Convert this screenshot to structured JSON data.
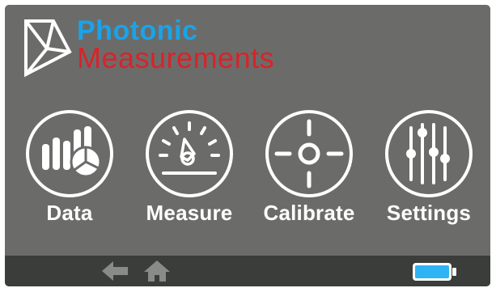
{
  "brand": {
    "line1": "Photonic",
    "line2": "Measurements",
    "line1_color": "#1aa3e8",
    "line2_color": "#d8232a",
    "logo_icon": "photonic-logo-mark"
  },
  "apps": [
    {
      "label": "Data",
      "icon": "data-charts-icon"
    },
    {
      "label": "Measure",
      "icon": "gauge-icon"
    },
    {
      "label": "Calibrate",
      "icon": "crosshair-icon"
    },
    {
      "label": "Settings",
      "icon": "sliders-icon"
    }
  ],
  "footer": {
    "back_icon": "back-arrow-icon",
    "home_icon": "home-icon",
    "battery_icon": "battery-icon",
    "battery_fill_color": "#2eb4f2"
  },
  "colors": {
    "screen_bg": "#6b6c6a",
    "footer_bg": "#3b3d3b",
    "icon_stroke": "#ffffff",
    "footer_icon": "#8a8b89"
  }
}
